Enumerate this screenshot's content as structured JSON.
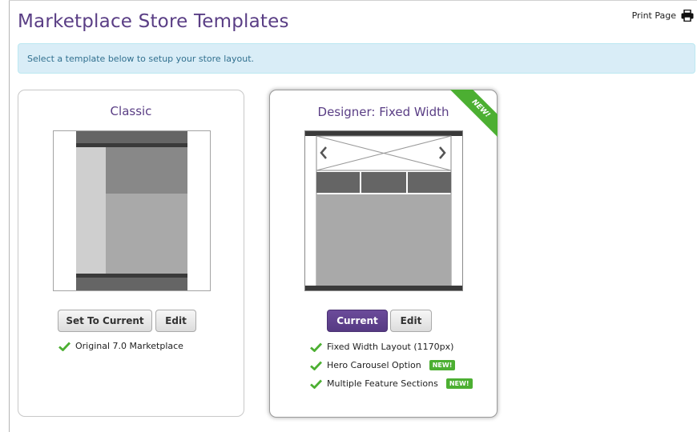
{
  "page": {
    "title": "Marketplace Store Templates",
    "print_label": "Print Page",
    "info_message": "Select a template below to setup your store layout."
  },
  "colors": {
    "accent": "#5a3e85",
    "new_badge": "#4caf32",
    "check": "#4caf32",
    "info_bg": "#d9edf7"
  },
  "templates": [
    {
      "title": "Classic",
      "is_current": false,
      "primary_button": "Set To Current",
      "edit_button": "Edit",
      "features": [
        {
          "label": "Original 7.0 Marketplace",
          "new": false
        }
      ]
    },
    {
      "title": "Designer: Fixed Width",
      "is_current": true,
      "ribbon": "NEW!",
      "primary_button": "Current",
      "edit_button": "Edit",
      "features": [
        {
          "label": "Fixed Width Layout (1170px)",
          "new": false
        },
        {
          "label": "Hero Carousel Option",
          "new": true,
          "badge": "NEW!"
        },
        {
          "label": "Multiple Feature Sections",
          "new": true,
          "badge": "NEW!"
        }
      ]
    }
  ],
  "icons": {
    "print": "printer-icon",
    "check": "checkmark-icon",
    "carousel_prev": "chevron-left-icon",
    "carousel_next": "chevron-right-icon"
  }
}
